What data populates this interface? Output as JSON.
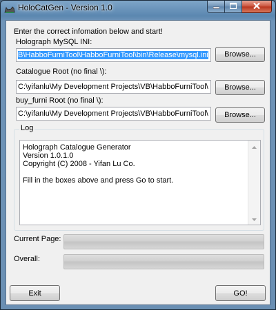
{
  "window": {
    "title": "HoloCatGen - Version 1.0",
    "icon": "cat-icon"
  },
  "form": {
    "instruction": "Enter the correct infomation below and start!",
    "mysql_label": "Holograph MySQL INI:",
    "mysql_value": "B\\HabboFurniTool\\HabboFurniTool\\bin\\Release\\mysql.ini",
    "catalogue_label": "Catalogue Root (no final \\):",
    "catalogue_value": "C:\\yifanlu\\My Development Projects\\VB\\HabboFurniTool\\",
    "buyfurni_label": "buy_furni Root (no final \\):",
    "buyfurni_value": "C:\\yifanlu\\My Development Projects\\VB\\HabboFurniTool\\",
    "browse_label": "Browse..."
  },
  "log": {
    "title": "Log",
    "lines": [
      "Holograph Catalogue Generator",
      "Version 1.0.1.0",
      "Copyright (C) 2008 - Yifan Lu Co.",
      "",
      "Fill in the boxes above and press Go to start."
    ]
  },
  "progress": {
    "current_label": "Current Page:",
    "overall_label": "Overall:",
    "current_value": 0,
    "overall_value": 0
  },
  "buttons": {
    "exit": "Exit",
    "go": "GO!"
  },
  "colors": {
    "selection": "#3399ff",
    "client_bg": "#f0f0f0",
    "title_glass": "#5b87b0",
    "close_red": "#c9503a"
  }
}
